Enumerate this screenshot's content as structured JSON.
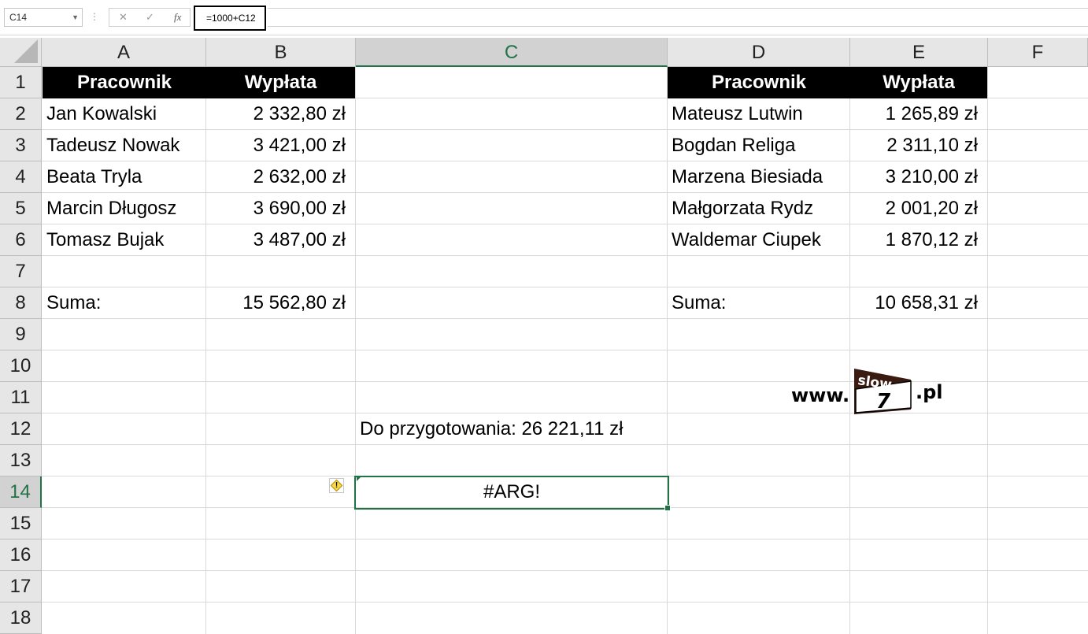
{
  "formula_bar": {
    "name_box": "C14",
    "cancel_icon": "✕",
    "enter_icon": "✓",
    "fx_label": "fx",
    "formula": "=1000+C12"
  },
  "columns": [
    "A",
    "B",
    "C",
    "D",
    "E",
    "F"
  ],
  "rows": [
    "1",
    "2",
    "3",
    "4",
    "5",
    "6",
    "7",
    "8",
    "9",
    "10",
    "11",
    "12",
    "13",
    "14",
    "15",
    "16",
    "17",
    "18"
  ],
  "selected_column": "C",
  "selected_row": "14",
  "table_left": {
    "header": [
      "Pracownik",
      "Wypłata"
    ],
    "rows": [
      [
        "Jan Kowalski",
        "2 332,80 zł"
      ],
      [
        "Tadeusz Nowak",
        "3 421,00 zł"
      ],
      [
        "Beata Tryla",
        "2 632,00 zł"
      ],
      [
        "Marcin Długosz",
        "3 690,00 zł"
      ],
      [
        "Tomasz Bujak",
        "3 487,00 zł"
      ]
    ],
    "sum_label": "Suma:",
    "sum_value": "15 562,80 zł"
  },
  "table_right": {
    "header": [
      "Pracownik",
      "Wypłata"
    ],
    "rows": [
      [
        "Mateusz Lutwin",
        "1 265,89 zł"
      ],
      [
        "Bogdan Religa",
        "2 311,10 zł"
      ],
      [
        "Marzena Biesiada",
        "3 210,00 zł"
      ],
      [
        "Małgorzata Rydz",
        "2 001,20 zł"
      ],
      [
        "Waldemar Ciupek",
        "1 870,12 zł"
      ]
    ],
    "sum_label": "Suma:",
    "sum_value": "10 658,31 zł"
  },
  "c12": "Do przygotowania: 26 221,11 zł",
  "c14": "#ARG!",
  "logo": {
    "www": "www.",
    "badge_top": "slow",
    "badge_num": "7",
    "tld": ".pl"
  },
  "colors": {
    "accent": "#217346",
    "header_bg": "#000000",
    "logo_dark": "#3b1a12"
  }
}
